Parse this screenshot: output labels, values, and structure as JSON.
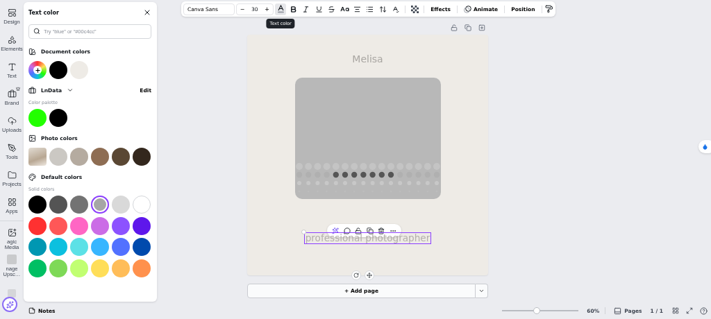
{
  "rail": [
    {
      "label": "Design"
    },
    {
      "label": "Elements"
    },
    {
      "label": "Text"
    },
    {
      "label": "Brand"
    },
    {
      "label": "Uploads"
    },
    {
      "label": "Tools"
    },
    {
      "label": "Projects"
    },
    {
      "label": "Apps"
    },
    {
      "label": "agic Media"
    },
    {
      "label": "nage Upsc…"
    }
  ],
  "panel": {
    "title": "Text color",
    "search": {
      "placeholder": "Try “blue” or “#00c4cc”"
    },
    "document_colors": {
      "title": "Document colors",
      "swatches": [
        {
          "kind": "add"
        },
        {
          "kind": "color",
          "color": "#000000"
        },
        {
          "kind": "color",
          "color": "#eeebe6"
        }
      ]
    },
    "brand": {
      "name": "LnData",
      "action": "Edit",
      "palette_label": "Color palette",
      "swatches": [
        {
          "kind": "color",
          "color": "#22ff00"
        },
        {
          "kind": "color",
          "color": "#000000"
        }
      ]
    },
    "photo_colors": {
      "title": "Photo colors",
      "swatches": [
        {
          "kind": "photo"
        },
        {
          "kind": "color",
          "color": "#cbc8c3"
        },
        {
          "kind": "color",
          "color": "#b5aba0"
        },
        {
          "kind": "color",
          "color": "#8e6d53"
        },
        {
          "kind": "color",
          "color": "#5a4733"
        },
        {
          "kind": "color",
          "color": "#33271d"
        }
      ]
    },
    "default_colors": {
      "title": "Default colors",
      "subtitle": "Solid colors",
      "swatches": [
        {
          "color": "#000000",
          "selected": false
        },
        {
          "color": "#545454",
          "selected": false
        },
        {
          "color": "#737373",
          "selected": false
        },
        {
          "color": "#a6a6a6",
          "selected": true
        },
        {
          "color": "#d9d9d9",
          "selected": false
        },
        {
          "color": "#ffffff",
          "selected": false
        },
        {
          "color": "#ff3131",
          "selected": false
        },
        {
          "color": "#ff5757",
          "selected": false
        },
        {
          "color": "#ff66c4",
          "selected": false
        },
        {
          "color": "#cb6ce6",
          "selected": false
        },
        {
          "color": "#8c52ff",
          "selected": false
        },
        {
          "color": "#5e17eb",
          "selected": false
        },
        {
          "color": "#0097b2",
          "selected": false
        },
        {
          "color": "#0cc0df",
          "selected": false
        },
        {
          "color": "#5ce1e6",
          "selected": false
        },
        {
          "color": "#38b6ff",
          "selected": false
        },
        {
          "color": "#5271ff",
          "selected": false
        },
        {
          "color": "#004aad",
          "selected": false
        },
        {
          "color": "#00bf63",
          "selected": false
        },
        {
          "color": "#7ed957",
          "selected": false
        },
        {
          "color": "#c1ff72",
          "selected": false
        },
        {
          "color": "#ffde59",
          "selected": false
        },
        {
          "color": "#ffbd59",
          "selected": false
        },
        {
          "color": "#ff914d",
          "selected": false
        }
      ]
    }
  },
  "toolbar": {
    "font": "Canva Sans",
    "minus": "−",
    "size": "30",
    "plus": "+",
    "tools": [
      {
        "kind": "text-color",
        "selected": true,
        "tooltip": "Text color"
      },
      {
        "kind": "bold",
        "selected": false
      },
      {
        "kind": "italic",
        "selected": false
      },
      {
        "kind": "underline",
        "selected": false
      },
      {
        "kind": "strikethrough",
        "selected": false
      },
      {
        "kind": "case",
        "selected": false
      },
      {
        "kind": "align",
        "selected": false
      },
      {
        "kind": "list",
        "selected": false
      },
      {
        "kind": "spacing",
        "selected": false
      },
      {
        "kind": "format",
        "selected": false
      },
      {
        "kind": "transparency",
        "selected": false
      }
    ],
    "effects": "Effects",
    "animate": "Animate",
    "position": "Position"
  },
  "canvas": {
    "title": "Melisa",
    "subtitle": "professional photographer",
    "subtitle_selected": true,
    "add_page": "+ Add page"
  },
  "bottom": {
    "notes": "Notes",
    "zoom": {
      "level": 0.45,
      "reading": "60%"
    },
    "pages": "Pages",
    "page_count": "1 / 1"
  }
}
